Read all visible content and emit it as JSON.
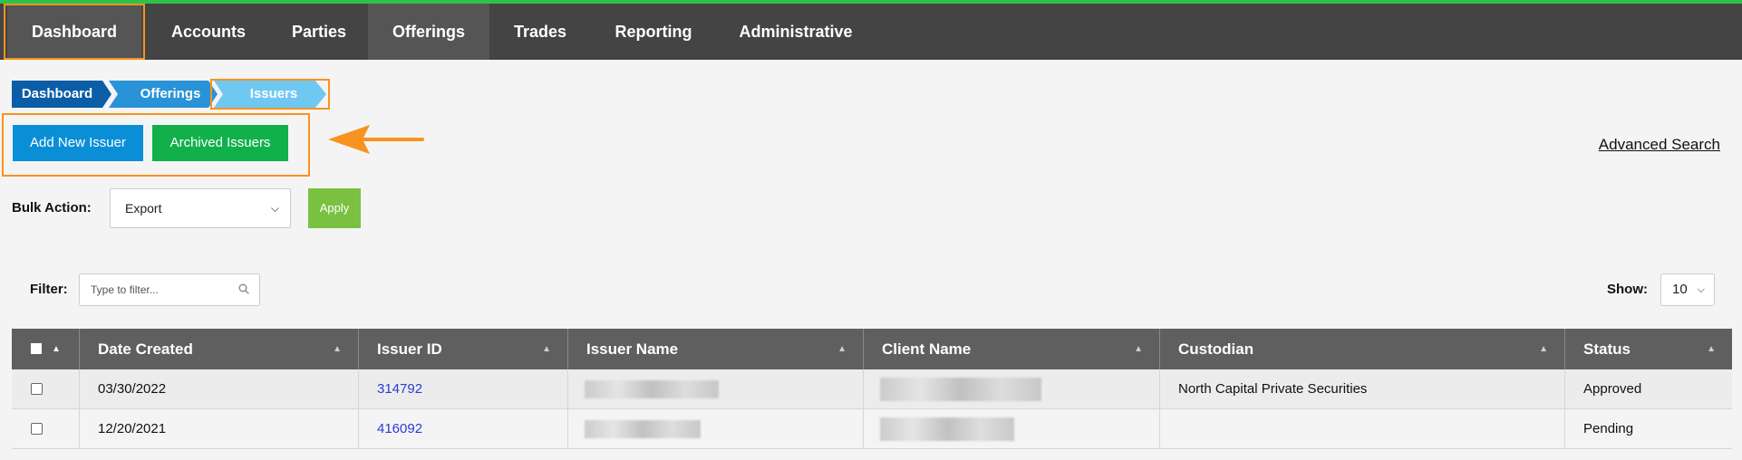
{
  "nav": {
    "items": [
      {
        "label": "Dashboard"
      },
      {
        "label": "Accounts"
      },
      {
        "label": "Parties"
      },
      {
        "label": "Offerings"
      },
      {
        "label": "Trades"
      },
      {
        "label": "Reporting"
      },
      {
        "label": "Administrative"
      }
    ]
  },
  "breadcrumb": [
    "Dashboard",
    "Offerings",
    "Issuers"
  ],
  "actions": {
    "add_new": "Add New Issuer",
    "archived": "Archived Issuers",
    "advanced_search": "Advanced Search"
  },
  "bulk": {
    "label": "Bulk Action:",
    "selected": "Export",
    "apply": "Apply"
  },
  "filter": {
    "label": "Filter:",
    "placeholder": "Type to filter..."
  },
  "show": {
    "label": "Show:",
    "value": "10"
  },
  "table": {
    "columns": [
      "Date Created",
      "Issuer ID",
      "Issuer Name",
      "Client Name",
      "Custodian",
      "Status"
    ],
    "rows": [
      {
        "date": "03/30/2022",
        "issuer_id": "314792",
        "custodian": "North Capital Private Securities",
        "status": "Approved"
      },
      {
        "date": "12/20/2021",
        "issuer_id": "416092",
        "custodian": "",
        "status": "Pending"
      }
    ]
  },
  "colors": {
    "nav_bg": "#444444",
    "accent_green": "#2fc24a",
    "highlight_orange": "#f7931e",
    "btn_blue": "#0a8fd6",
    "btn_green": "#11b04b",
    "apply_green": "#7ac142",
    "crumb_dark": "#0b5da6",
    "crumb_mid": "#2a93d8",
    "crumb_light": "#6fc8f2"
  }
}
